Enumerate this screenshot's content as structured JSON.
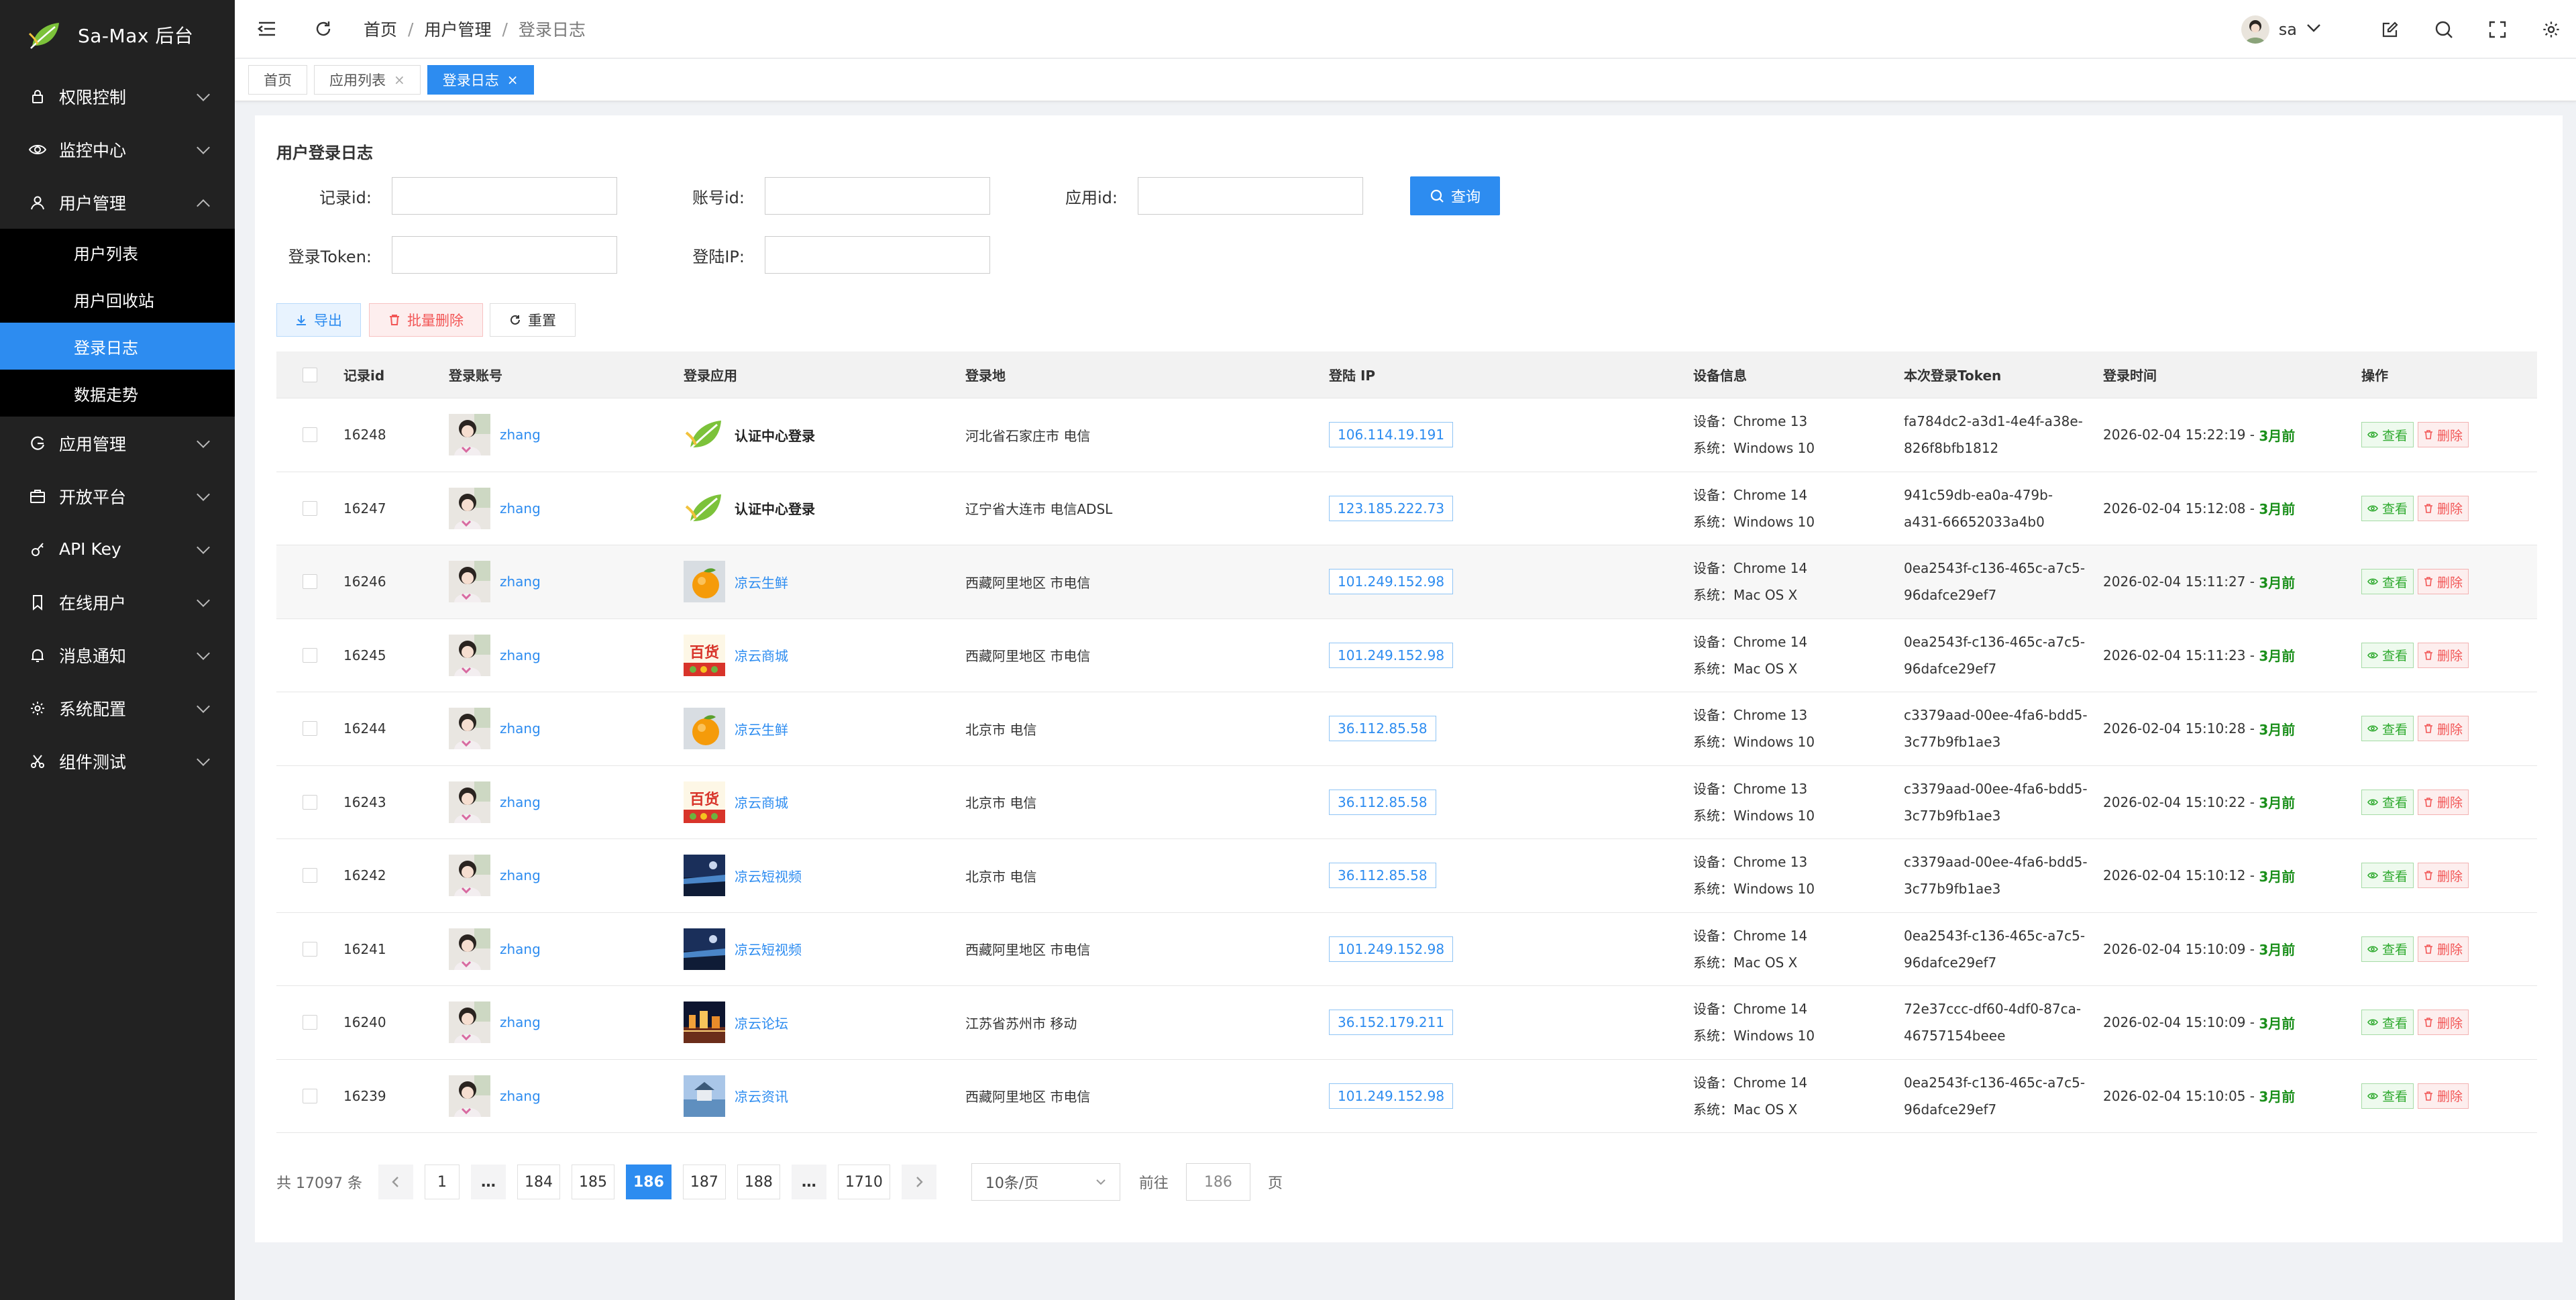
{
  "app": {
    "title": "Sa-Max 后台",
    "accent": "#2d8cf0",
    "sidebar_bg": "#222222"
  },
  "sidebar": {
    "items": [
      {
        "label": "权限控制",
        "icon": "lock-icon"
      },
      {
        "label": "监控中心",
        "icon": "eye-icon"
      },
      {
        "label": "用户管理",
        "icon": "user-icon",
        "expanded": true
      },
      {
        "label": "应用管理",
        "icon": "app-icon"
      },
      {
        "label": "开放平台",
        "icon": "platform-icon"
      },
      {
        "label": "API Key",
        "icon": "key-icon"
      },
      {
        "label": "在线用户",
        "icon": "bookmark-icon"
      },
      {
        "label": "消息通知",
        "icon": "bell-icon"
      },
      {
        "label": "系统配置",
        "icon": "gear-icon"
      },
      {
        "label": "组件测试",
        "icon": "scissors-icon"
      }
    ],
    "user_submenu": [
      "用户列表",
      "用户回收站",
      "登录日志",
      "数据走势"
    ],
    "active_sub": "登录日志"
  },
  "header": {
    "breadcrumb": [
      "首页",
      "用户管理",
      "登录日志"
    ],
    "user": "sa"
  },
  "tabs": [
    {
      "label": "首页",
      "closable": false
    },
    {
      "label": "应用列表",
      "closable": true
    },
    {
      "label": "登录日志",
      "closable": true,
      "active": true
    }
  ],
  "page": {
    "title": "用户登录日志",
    "filters": {
      "record_id_label": "记录id:",
      "account_id_label": "账号id:",
      "app_id_label": "应用id:",
      "token_label": "登录Token:",
      "ip_label": "登陆IP:",
      "search_label": "查询"
    },
    "actions": {
      "export": "导出",
      "batch_delete": "批量删除",
      "reset": "重置"
    },
    "columns": [
      "记录id",
      "登录账号",
      "登录应用",
      "登录地",
      "登陆 IP",
      "设备信息",
      "本次登录Token",
      "登录时间",
      "操作"
    ],
    "view_label": "查看",
    "delete_label": "删除",
    "rows": [
      {
        "id": "16248",
        "account": "zhang",
        "app": "认证中心登录",
        "app_icon": "leaf",
        "location": "河北省石家庄市 电信",
        "ip": "106.114.19.191",
        "device": "设备：Chrome 13",
        "os": "系统：Windows 10",
        "token1": "fa784dc2-a3d1-4e4f-a38e-",
        "token2": "826f8bfb1812",
        "time": "2026-02-04 15:22:19 - ",
        "ago": "3月前"
      },
      {
        "id": "16247",
        "account": "zhang",
        "app": "认证中心登录",
        "app_icon": "leaf",
        "location": "辽宁省大连市 电信ADSL",
        "ip": "123.185.222.73",
        "device": "设备：Chrome 14",
        "os": "系统：Windows 10",
        "token1": "941c59db-ea0a-479b-",
        "token2": "a431-66652033a4b0",
        "time": "2026-02-04 15:12:08 - ",
        "ago": "3月前"
      },
      {
        "id": "16246",
        "account": "zhang",
        "app": "凉云生鲜",
        "app_icon": "orange",
        "location": "西藏阿里地区 市电信",
        "ip": "101.249.152.98",
        "device": "设备：Chrome 14",
        "os": "系统：Mac OS X",
        "token1": "0ea2543f-c136-465c-a7c5-",
        "token2": "96dafce29ef7",
        "time": "2026-02-04 15:11:27 - ",
        "ago": "3月前"
      },
      {
        "id": "16245",
        "account": "zhang",
        "app": "凉云商城",
        "app_icon": "mall",
        "location": "西藏阿里地区 市电信",
        "ip": "101.249.152.98",
        "device": "设备：Chrome 14",
        "os": "系统：Mac OS X",
        "token1": "0ea2543f-c136-465c-a7c5-",
        "token2": "96dafce29ef7",
        "time": "2026-02-04 15:11:23 - ",
        "ago": "3月前"
      },
      {
        "id": "16244",
        "account": "zhang",
        "app": "凉云生鲜",
        "app_icon": "orange",
        "location": "北京市 电信",
        "ip": "36.112.85.58",
        "device": "设备：Chrome 13",
        "os": "系统：Windows 10",
        "token1": "c3379aad-00ee-4fa6-bdd5-",
        "token2": "3c77b9fb1ae3",
        "time": "2026-02-04 15:10:28 - ",
        "ago": "3月前"
      },
      {
        "id": "16243",
        "account": "zhang",
        "app": "凉云商城",
        "app_icon": "mall",
        "location": "北京市 电信",
        "ip": "36.112.85.58",
        "device": "设备：Chrome 13",
        "os": "系统：Windows 10",
        "token1": "c3379aad-00ee-4fa6-bdd5-",
        "token2": "3c77b9fb1ae3",
        "time": "2026-02-04 15:10:22 - ",
        "ago": "3月前"
      },
      {
        "id": "16242",
        "account": "zhang",
        "app": "凉云短视频",
        "app_icon": "video",
        "location": "北京市 电信",
        "ip": "36.112.85.58",
        "device": "设备：Chrome 13",
        "os": "系统：Windows 10",
        "token1": "c3379aad-00ee-4fa6-bdd5-",
        "token2": "3c77b9fb1ae3",
        "time": "2026-02-04 15:10:12 - ",
        "ago": "3月前"
      },
      {
        "id": "16241",
        "account": "zhang",
        "app": "凉云短视频",
        "app_icon": "video",
        "location": "西藏阿里地区 市电信",
        "ip": "101.249.152.98",
        "device": "设备：Chrome 14",
        "os": "系统：Mac OS X",
        "token1": "0ea2543f-c136-465c-a7c5-",
        "token2": "96dafce29ef7",
        "time": "2026-02-04 15:10:09 - ",
        "ago": "3月前"
      },
      {
        "id": "16240",
        "account": "zhang",
        "app": "凉云论坛",
        "app_icon": "forum",
        "location": "江苏省苏州市 移动",
        "ip": "36.152.179.211",
        "device": "设备：Chrome 14",
        "os": "系统：Windows 10",
        "token1": "72e37ccc-df60-4df0-87ca-",
        "token2": "46757154beee",
        "time": "2026-02-04 15:10:09 - ",
        "ago": "3月前"
      },
      {
        "id": "16239",
        "account": "zhang",
        "app": "凉云资讯",
        "app_icon": "news",
        "location": "西藏阿里地区 市电信",
        "ip": "101.249.152.98",
        "device": "设备：Chrome 14",
        "os": "系统：Mac OS X",
        "token1": "0ea2543f-c136-465c-a7c5-",
        "token2": "96dafce29ef7",
        "time": "2026-02-04 15:10:05 - ",
        "ago": "3月前"
      }
    ]
  },
  "pagination": {
    "total_text": "共 17097 条",
    "pages": [
      "1",
      "…",
      "184",
      "185",
      "186",
      "187",
      "188",
      "…",
      "1710"
    ],
    "current": "186",
    "page_size": "10条/页",
    "goto_label": "前往",
    "goto_value": "186",
    "page_suffix": "页"
  }
}
